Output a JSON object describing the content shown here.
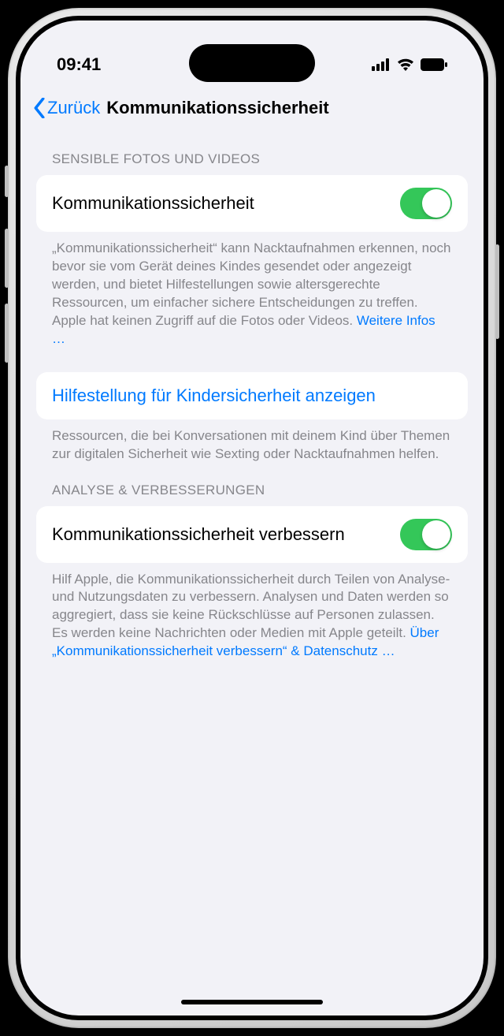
{
  "status": {
    "time": "09:41"
  },
  "nav": {
    "back_label": "Zurück",
    "title": "Kommunikationssicherheit"
  },
  "section1": {
    "header": "SENSIBLE FOTOS UND VIDEOS",
    "toggle_label": "Kommunikationssicherheit",
    "toggle_on": true,
    "footer_text": "„Kommunikationssicherheit“ kann Nacktaufnahmen erkennen, noch bevor sie vom Gerät deines Kindes gesendet oder angezeigt werden, und bietet Hilfestellungen sowie altersgerechte Ressourcen, um einfacher sichere Entscheidungen zu treffen. Apple hat keinen Zugriff auf die Fotos oder Videos. ",
    "footer_link": "Weitere Infos …"
  },
  "section2": {
    "link_label": "Hilfestellung für Kindersicherheit anzeigen",
    "footer_text": "Ressourcen, die bei Konversationen mit deinem Kind über Themen zur digitalen Sicherheit wie Sexting oder Nacktaufnahmen helfen."
  },
  "section3": {
    "header": "ANALYSE & VERBESSERUNGEN",
    "toggle_label": "Kommunikationssicherheit verbessern",
    "toggle_on": true,
    "footer_text": "Hilf Apple, die Kommunikationssicherheit durch Teilen von Analyse- und Nutzungsdaten zu verbessern. Analysen und Daten werden so aggregiert, dass sie keine Rückschlüsse auf Personen zulassen. Es werden keine Nachrichten oder Medien mit Apple geteilt. ",
    "footer_link": "Über „Kommunikationssicherheit verbessern“ & Daten­schutz …"
  }
}
